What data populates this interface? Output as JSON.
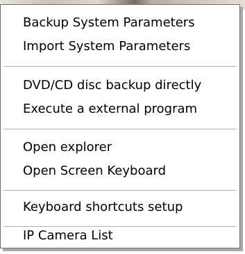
{
  "menu": {
    "groups": [
      {
        "items": [
          {
            "label": "Backup System Parameters"
          },
          {
            "label": "Import System Parameters"
          }
        ]
      },
      {
        "items": [
          {
            "label": "DVD/CD disc backup directly"
          },
          {
            "label": "Execute a external program"
          }
        ]
      },
      {
        "items": [
          {
            "label": "Open explorer"
          },
          {
            "label": "Open Screen Keyboard"
          }
        ]
      },
      {
        "items": [
          {
            "label": "Keyboard shortcuts setup"
          }
        ]
      },
      {
        "items": [
          {
            "label": "IP Camera List"
          }
        ]
      }
    ]
  }
}
